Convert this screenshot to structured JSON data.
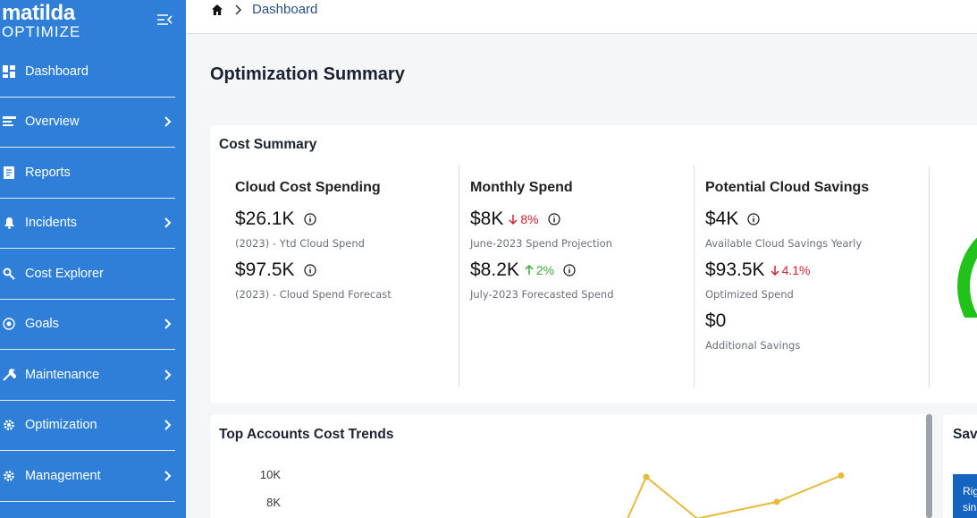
{
  "sidebar": {
    "logo_top": "matilda",
    "logo_bottom": "OPTIMIZE",
    "items": [
      {
        "label": "Dashboard",
        "icon": "dashboard-icon",
        "has_submenu": false
      },
      {
        "label": "Overview",
        "icon": "overview-icon",
        "has_submenu": true
      },
      {
        "label": "Reports",
        "icon": "reports-icon",
        "has_submenu": false
      },
      {
        "label": "Incidents",
        "icon": "bell-icon",
        "has_submenu": true
      },
      {
        "label": "Cost Explorer",
        "icon": "cost-explorer-icon",
        "has_submenu": false
      },
      {
        "label": "Goals",
        "icon": "goals-icon",
        "has_submenu": true
      },
      {
        "label": "Maintenance",
        "icon": "wrench-icon",
        "has_submenu": true
      },
      {
        "label": "Optimization",
        "icon": "gear-icon",
        "has_submenu": true
      },
      {
        "label": "Management",
        "icon": "gear-icon",
        "has_submenu": true
      }
    ]
  },
  "breadcrumb": {
    "current": "Dashboard"
  },
  "page": {
    "title": "Optimization Summary"
  },
  "cost_summary": {
    "title": "Cost Summary",
    "columns": [
      {
        "title": "Cloud Cost Spending",
        "metrics": [
          {
            "value": "$26.1K",
            "sub": "(2023) - Ytd Cloud Spend"
          },
          {
            "value": "$97.5K",
            "sub": "(2023) - Cloud Spend Forecast"
          }
        ]
      },
      {
        "title": "Monthly Spend",
        "metrics": [
          {
            "value": "$8K",
            "delta": "8%",
            "direction": "down",
            "sub": "June-2023 Spend Projection"
          },
          {
            "value": "$8.2K",
            "delta": "2%",
            "direction": "up",
            "sub": "July-2023 Forecasted Spend"
          }
        ]
      },
      {
        "title": "Potential Cloud Savings",
        "metrics": [
          {
            "value": "$4K",
            "sub": "Available Cloud Savings Yearly"
          },
          {
            "value": "$93.5K",
            "delta": "4.1%",
            "direction": "down",
            "sub": "Optimized Spend"
          },
          {
            "value": "$0",
            "sub": "Additional Savings"
          }
        ]
      }
    ]
  },
  "trends": {
    "title": "Top Accounts Cost Trends",
    "y_ticks": [
      "10K",
      "8K"
    ]
  },
  "savings_panel": {
    "title_visible": "Sav",
    "chip_text": [
      "Rig",
      "sin"
    ]
  },
  "colors": {
    "sidebar": "#2f7fd8",
    "trend_line": "#e8b93a",
    "gauge": "#22c21a",
    "down": "#d0232b",
    "up": "#3aaa35"
  },
  "chart_data": {
    "type": "line",
    "title": "Top Accounts Cost Trends",
    "ylim": [
      7000,
      10500
    ],
    "x": [
      0,
      1,
      2,
      3,
      4
    ],
    "series": [
      {
        "values": [
          6500,
          9800,
          6800,
          8000,
          9900
        ]
      }
    ]
  }
}
